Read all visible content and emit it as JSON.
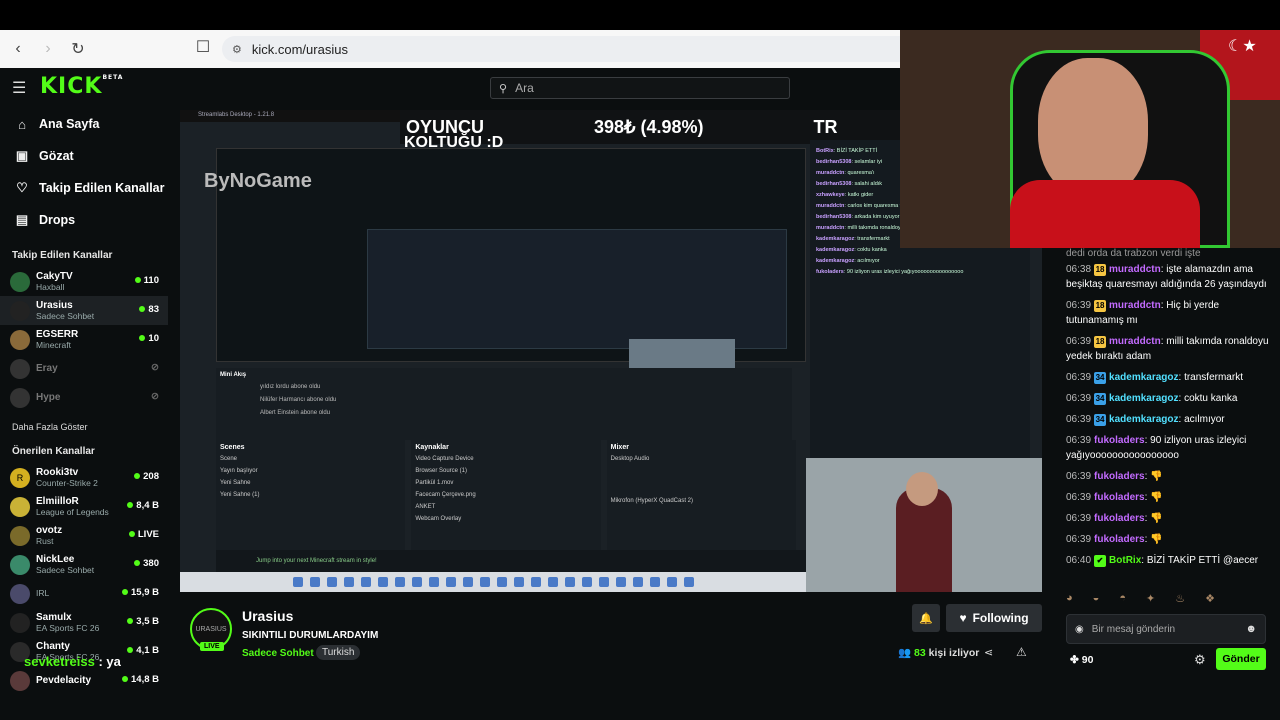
{
  "browser": {
    "url": "kick.com/urasius"
  },
  "header": {
    "logo": "KICK",
    "logo_badge": "BETA",
    "search_placeholder": "Ara"
  },
  "sidebar": {
    "nav": [
      {
        "label": "Ana Sayfa",
        "icon": "home-icon"
      },
      {
        "label": "Gözat",
        "icon": "browse-icon"
      },
      {
        "label": "Takip Edilen Kanallar",
        "icon": "heart-icon"
      },
      {
        "label": "Drops",
        "icon": "drops-icon"
      }
    ],
    "following_title": "Takip Edilen Kanallar",
    "following": [
      {
        "name": "CakyTV",
        "category": "Haxball",
        "viewers": "110",
        "live": true
      },
      {
        "name": "Urasius",
        "category": "Sadece Sohbet",
        "viewers": "83",
        "live": true
      },
      {
        "name": "EGSERR",
        "category": "Minecraft",
        "viewers": "10",
        "live": true
      },
      {
        "name": "Eray",
        "category": "",
        "viewers": "",
        "live": false
      },
      {
        "name": "Hype",
        "category": "",
        "viewers": "",
        "live": false
      }
    ],
    "show_more": "Daha Fazla Göster",
    "recommended_title": "Önerilen Kanallar",
    "recommended": [
      {
        "name": "Rooki3tv",
        "category": "Counter-Strike 2",
        "viewers": "208"
      },
      {
        "name": "ElmiilloR",
        "category": "League of Legends",
        "viewers": "8,4 B"
      },
      {
        "name": "ovotz",
        "category": "Rust",
        "viewers": "LIVE"
      },
      {
        "name": "NickLee",
        "category": "Sadece Sohbet",
        "viewers": "380"
      },
      {
        "name": "",
        "category": "IRL",
        "viewers": "15,9 B"
      },
      {
        "name": "Samulx",
        "category": "EA Sports FC 26",
        "viewers": "3,5 B"
      },
      {
        "name": "Chanty",
        "category": "EA Sports FC 26",
        "viewers": "4,1 B"
      },
      {
        "name": "Pevdelacity",
        "category": "",
        "viewers": "14,8 B"
      }
    ]
  },
  "stream_overlay": {
    "top_text_1": "OYUNCU",
    "top_text_2": "398₺ (4.98%)",
    "top_text_3": "TR",
    "koltugu": "KOLTUĞU :D",
    "obs_title": "Streamlabs Desktop - 1.21.8",
    "watermark": "ByNoGame",
    "chat_name_overlay_user": "sevketreiss",
    "chat_name_overlay_text": " : ya",
    "mini_akis": "Mini Akış",
    "mini_akis_rows": [
      "yıldız lordu  abone oldu",
      "Nilüfer Harmancı  abone oldu",
      "Albert Einstein  abone oldu"
    ],
    "scenes_title": "Scenes",
    "scenes": [
      "Scene",
      "Yayın başlıyor",
      "Yeni Sahne",
      "Yeni Sahne (1)"
    ],
    "sources_title": "Kaynaklar",
    "sources": [
      "Video Capture Device",
      "Browser Source (1)",
      "Partikül 1.mov",
      "Facecam Çerçeve.png",
      "ANKET",
      "Webcam Overlay"
    ],
    "mixer_title": "Mixer",
    "mixer": [
      "Desktop Audio",
      "Mikrofon (HyperX QuadCast 2)"
    ],
    "status_text": "Jump into your next Minecraft stream in style!",
    "obs_chat": [
      [
        "BotRix",
        "BİZİ TAKİP ETTİ"
      ],
      [
        "bedirhan5308",
        "selamlar iyi"
      ],
      [
        "muraddctn",
        "quaresma'ı"
      ],
      [
        "bedirhan5308",
        "salahi aldık"
      ],
      [
        "xzhawkeye",
        "katkı gider"
      ],
      [
        "muraddctn",
        "carlos kim quaresma varken ya"
      ],
      [
        "bedirhan5308",
        "arkada kim uyuyor kanka"
      ],
      [
        "muraddctn",
        "milli takımda ronaldoyu yedek bıraktı adam"
      ],
      [
        "kademkaragoz",
        "transfermarkt"
      ],
      [
        "kademkaragoz",
        "coktu kanka"
      ],
      [
        "kademkaragoz",
        "acılmıyor"
      ],
      [
        "fukoladers",
        "90 izliyon uras izleyici yağıyoooooooooooooooo"
      ]
    ]
  },
  "stream_info": {
    "avatar_text": "URASIUS",
    "live_badge": "LIVE",
    "name": "Urasius",
    "title": "SIKINTILI DURUMLARDAYIM",
    "category": "Sadece Sohbet",
    "tag": "Turkish",
    "follow_label": "Following",
    "viewers_count": "83",
    "viewers_label": "kişi izliyor"
  },
  "chat": {
    "partial_top": "dedi orda da trabzon verdi işte",
    "messages": [
      {
        "time": "06:38",
        "badge": "18",
        "badge_color": "#f5c542",
        "user": "muraddctn",
        "user_color": "#c36bff",
        "text": "işte alamazdın ama beşiktaş quaresmayı aldığında 26 yaşındaydı"
      },
      {
        "time": "06:39",
        "badge": "18",
        "badge_color": "#f5c542",
        "user": "muraddctn",
        "user_color": "#c36bff",
        "text": "Hiç bi yerde tutunamamış mı"
      },
      {
        "time": "06:39",
        "badge": "18",
        "badge_color": "#f5c542",
        "user": "muraddctn",
        "user_color": "#c36bff",
        "text": "milli takımda ronaldoyu yedek bıraktı adam"
      },
      {
        "time": "06:39",
        "badge": "34",
        "badge_color": "#3aa0e8",
        "user": "kademkaragoz",
        "user_color": "#52e0ff",
        "text": "transfermarkt"
      },
      {
        "time": "06:39",
        "badge": "34",
        "badge_color": "#3aa0e8",
        "user": "kademkaragoz",
        "user_color": "#52e0ff",
        "text": "coktu kanka"
      },
      {
        "time": "06:39",
        "badge": "34",
        "badge_color": "#3aa0e8",
        "user": "kademkaragoz",
        "user_color": "#52e0ff",
        "text": "acılmıyor"
      },
      {
        "time": "06:39",
        "badge": "",
        "badge_color": "",
        "user": "fukoladers",
        "user_color": "#c36bff",
        "text": "90 izliyon uras izleyici yağıyoooooooooooooooo"
      },
      {
        "time": "06:39",
        "badge": "",
        "badge_color": "",
        "user": "fukoladers",
        "user_color": "#c36bff",
        "text": "👎"
      },
      {
        "time": "06:39",
        "badge": "",
        "badge_color": "",
        "user": "fukoladers",
        "user_color": "#c36bff",
        "text": "👎"
      },
      {
        "time": "06:39",
        "badge": "",
        "badge_color": "",
        "user": "fukoladers",
        "user_color": "#c36bff",
        "text": "👎"
      },
      {
        "time": "06:39",
        "badge": "",
        "badge_color": "",
        "user": "fukoladers",
        "user_color": "#c36bff",
        "text": "👎"
      },
      {
        "time": "06:40",
        "badge": "✔",
        "badge_color": "#53fc18",
        "user": "BotRix",
        "user_color": "#53fc18",
        "text": "BİZİ TAKİP ETTİ @aecer"
      }
    ],
    "input_placeholder": "Bir mesaj gönderin",
    "points": "90",
    "send_label": "Gönder"
  },
  "colors": {
    "brand": "#53fc18",
    "bg": "#0b0e0f"
  }
}
